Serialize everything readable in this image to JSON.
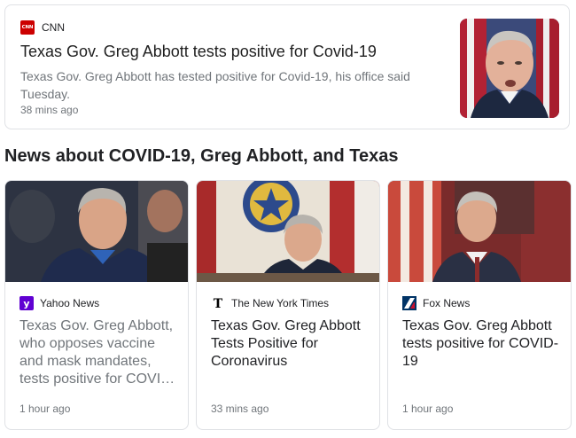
{
  "top_story": {
    "source": "CNN",
    "logo_text": "CNN",
    "title": "Texas Gov. Greg Abbott tests positive for Covid-19",
    "snippet": "Texas Gov. Greg Abbott has tested positive for Covid-19, his office said Tuesday.",
    "time": "38 mins ago"
  },
  "section": {
    "heading": "News about COVID-19, Greg Abbott, and Texas"
  },
  "cards": [
    {
      "source": "Yahoo News",
      "icon": "yahoo-icon",
      "icon_color": "#6001d2",
      "title": "Texas Gov. Greg Abbott, who opposes vaccine and mask mandates, tests positive for COVI…",
      "time": "1 hour ago"
    },
    {
      "source": "The New York Times",
      "icon": "nyt-icon",
      "icon_color": "#000000",
      "title": "Texas Gov. Greg Abbott Tests Positive for Coronavirus",
      "time": "33 mins ago"
    },
    {
      "source": "Fox News",
      "icon": "fox-news-icon",
      "icon_color": "#003366",
      "title": "Texas Gov. Greg Abbott tests positive for COVID-19",
      "time": "1 hour ago"
    }
  ]
}
